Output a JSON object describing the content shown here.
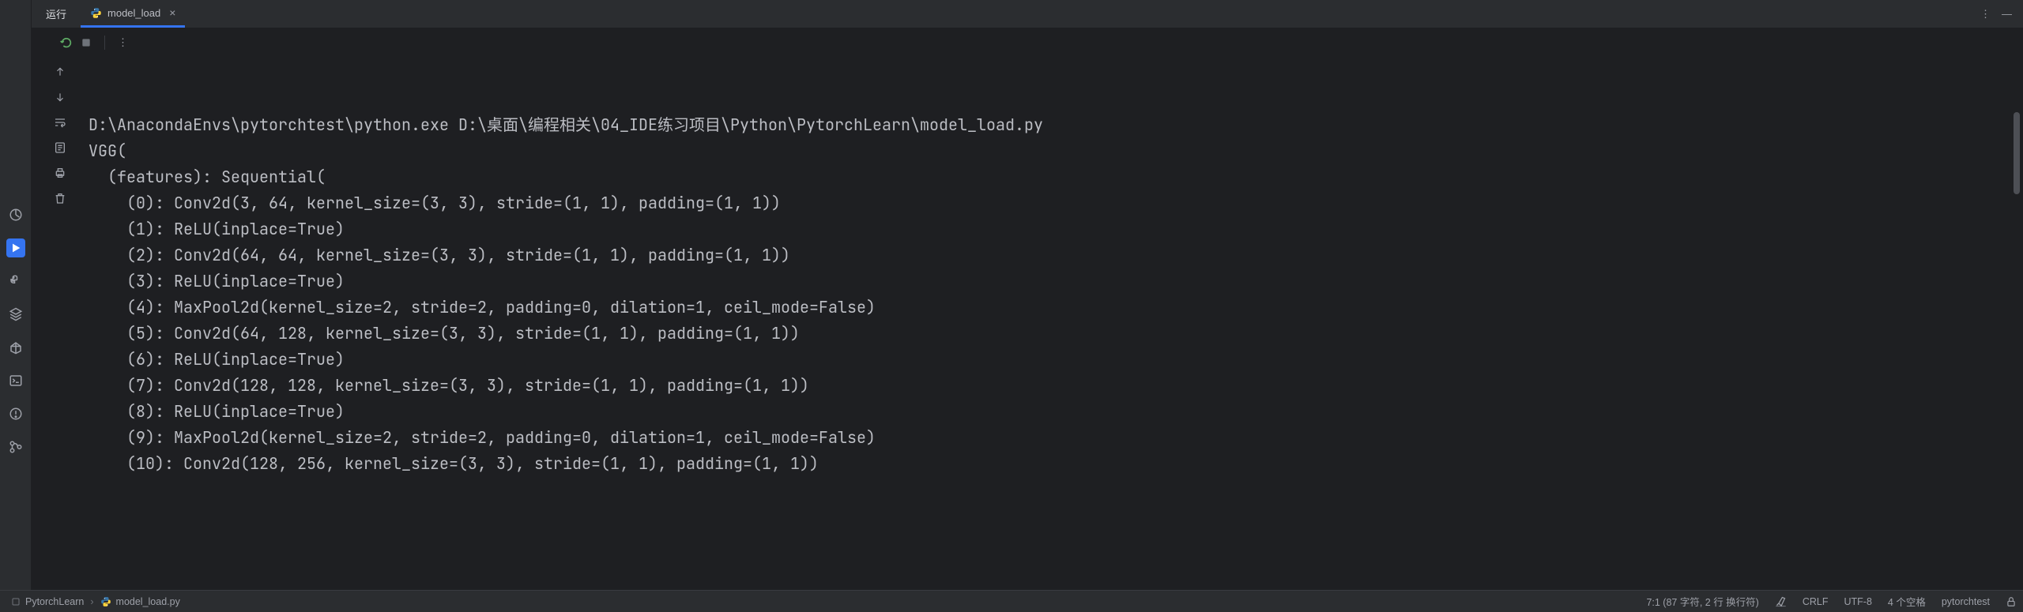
{
  "tabs": {
    "run_label": "运行",
    "tab_name": "model_load"
  },
  "console_lines": [
    "D:\\AnacondaEnvs\\pytorchtest\\python.exe D:\\桌面\\编程相关\\04_IDE练习项目\\Python\\PytorchLearn\\model_load.py",
    "VGG(",
    "  (features): Sequential(",
    "    (0): Conv2d(3, 64, kernel_size=(3, 3), stride=(1, 1), padding=(1, 1))",
    "    (1): ReLU(inplace=True)",
    "    (2): Conv2d(64, 64, kernel_size=(3, 3), stride=(1, 1), padding=(1, 1))",
    "    (3): ReLU(inplace=True)",
    "    (4): MaxPool2d(kernel_size=2, stride=2, padding=0, dilation=1, ceil_mode=False)",
    "    (5): Conv2d(64, 128, kernel_size=(3, 3), stride=(1, 1), padding=(1, 1))",
    "    (6): ReLU(inplace=True)",
    "    (7): Conv2d(128, 128, kernel_size=(3, 3), stride=(1, 1), padding=(1, 1))",
    "    (8): ReLU(inplace=True)",
    "    (9): MaxPool2d(kernel_size=2, stride=2, padding=0, dilation=1, ceil_mode=False)",
    "    (10): Conv2d(128, 256, kernel_size=(3, 3), stride=(1, 1), padding=(1, 1))"
  ],
  "status": {
    "project": "PytorchLearn",
    "file": "model_load.py",
    "position": "7:1 (87 字符, 2 行 换行符)",
    "line_sep": "CRLF",
    "encoding": "UTF-8",
    "indent": "4 个空格",
    "interpreter": "pytorchtest"
  }
}
